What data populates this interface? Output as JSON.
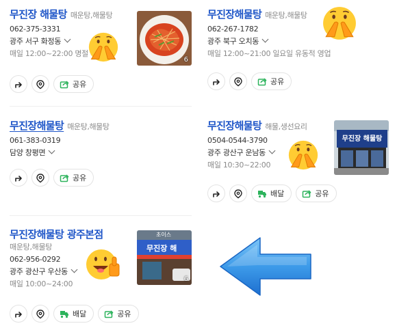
{
  "listings": [
    {
      "name": "무진장 해물탕",
      "category": "매운탕,해물탕",
      "phone": "062-375-3331",
      "address": "광주 서구 화정동",
      "hours": "매일 12:00~22:00 명절 휴",
      "photo_count": "6",
      "share_label": "공유"
    },
    {
      "name": "무진장해물탕",
      "category": "매운탕,해물탕",
      "phone": "062-267-1782",
      "address": "광주 북구 오치동",
      "hours": "매일 12:00~21:00 일요일 유동적 영업",
      "share_label": "공유"
    },
    {
      "name": "무진장해물탕",
      "category": "매운탕,해물탕",
      "phone": "061-383-0319",
      "address": "담양 창평면",
      "share_label": "공유"
    },
    {
      "name": "무진장해물탕",
      "category": "해물,생선요리",
      "phone": "0504-0544-3790",
      "address": "광주 광산구 운남동",
      "hours": "매일 10:30~22:00",
      "delivery_label": "배달",
      "share_label": "공유"
    },
    {
      "name": "무진장해물탕 광주본점",
      "category": "매운탕,해물탕",
      "phone": "062-956-0292",
      "address": "광주 광산구 우산동",
      "hours": "매일 10:00~24:00",
      "photo_count": "6",
      "delivery_label": "배달",
      "share_label": "공유"
    }
  ],
  "signs": {
    "photo4_sign": "무진장 해물탕",
    "photo5_sign_top": "초이스",
    "photo5_sign": "무진장 해"
  },
  "colors": {
    "title_blue": "#1f56c8",
    "share_green": "#2db35c",
    "arrow_blue": "#3d9be9",
    "emoji_yellow": "#ffcc33"
  },
  "icons": [
    "directions-icon",
    "map-pin-icon",
    "share-icon",
    "delivery-icon",
    "chevron-down-icon",
    "face-emoji-icon",
    "thumbs-up-emoji-icon",
    "left-arrow-icon"
  ]
}
